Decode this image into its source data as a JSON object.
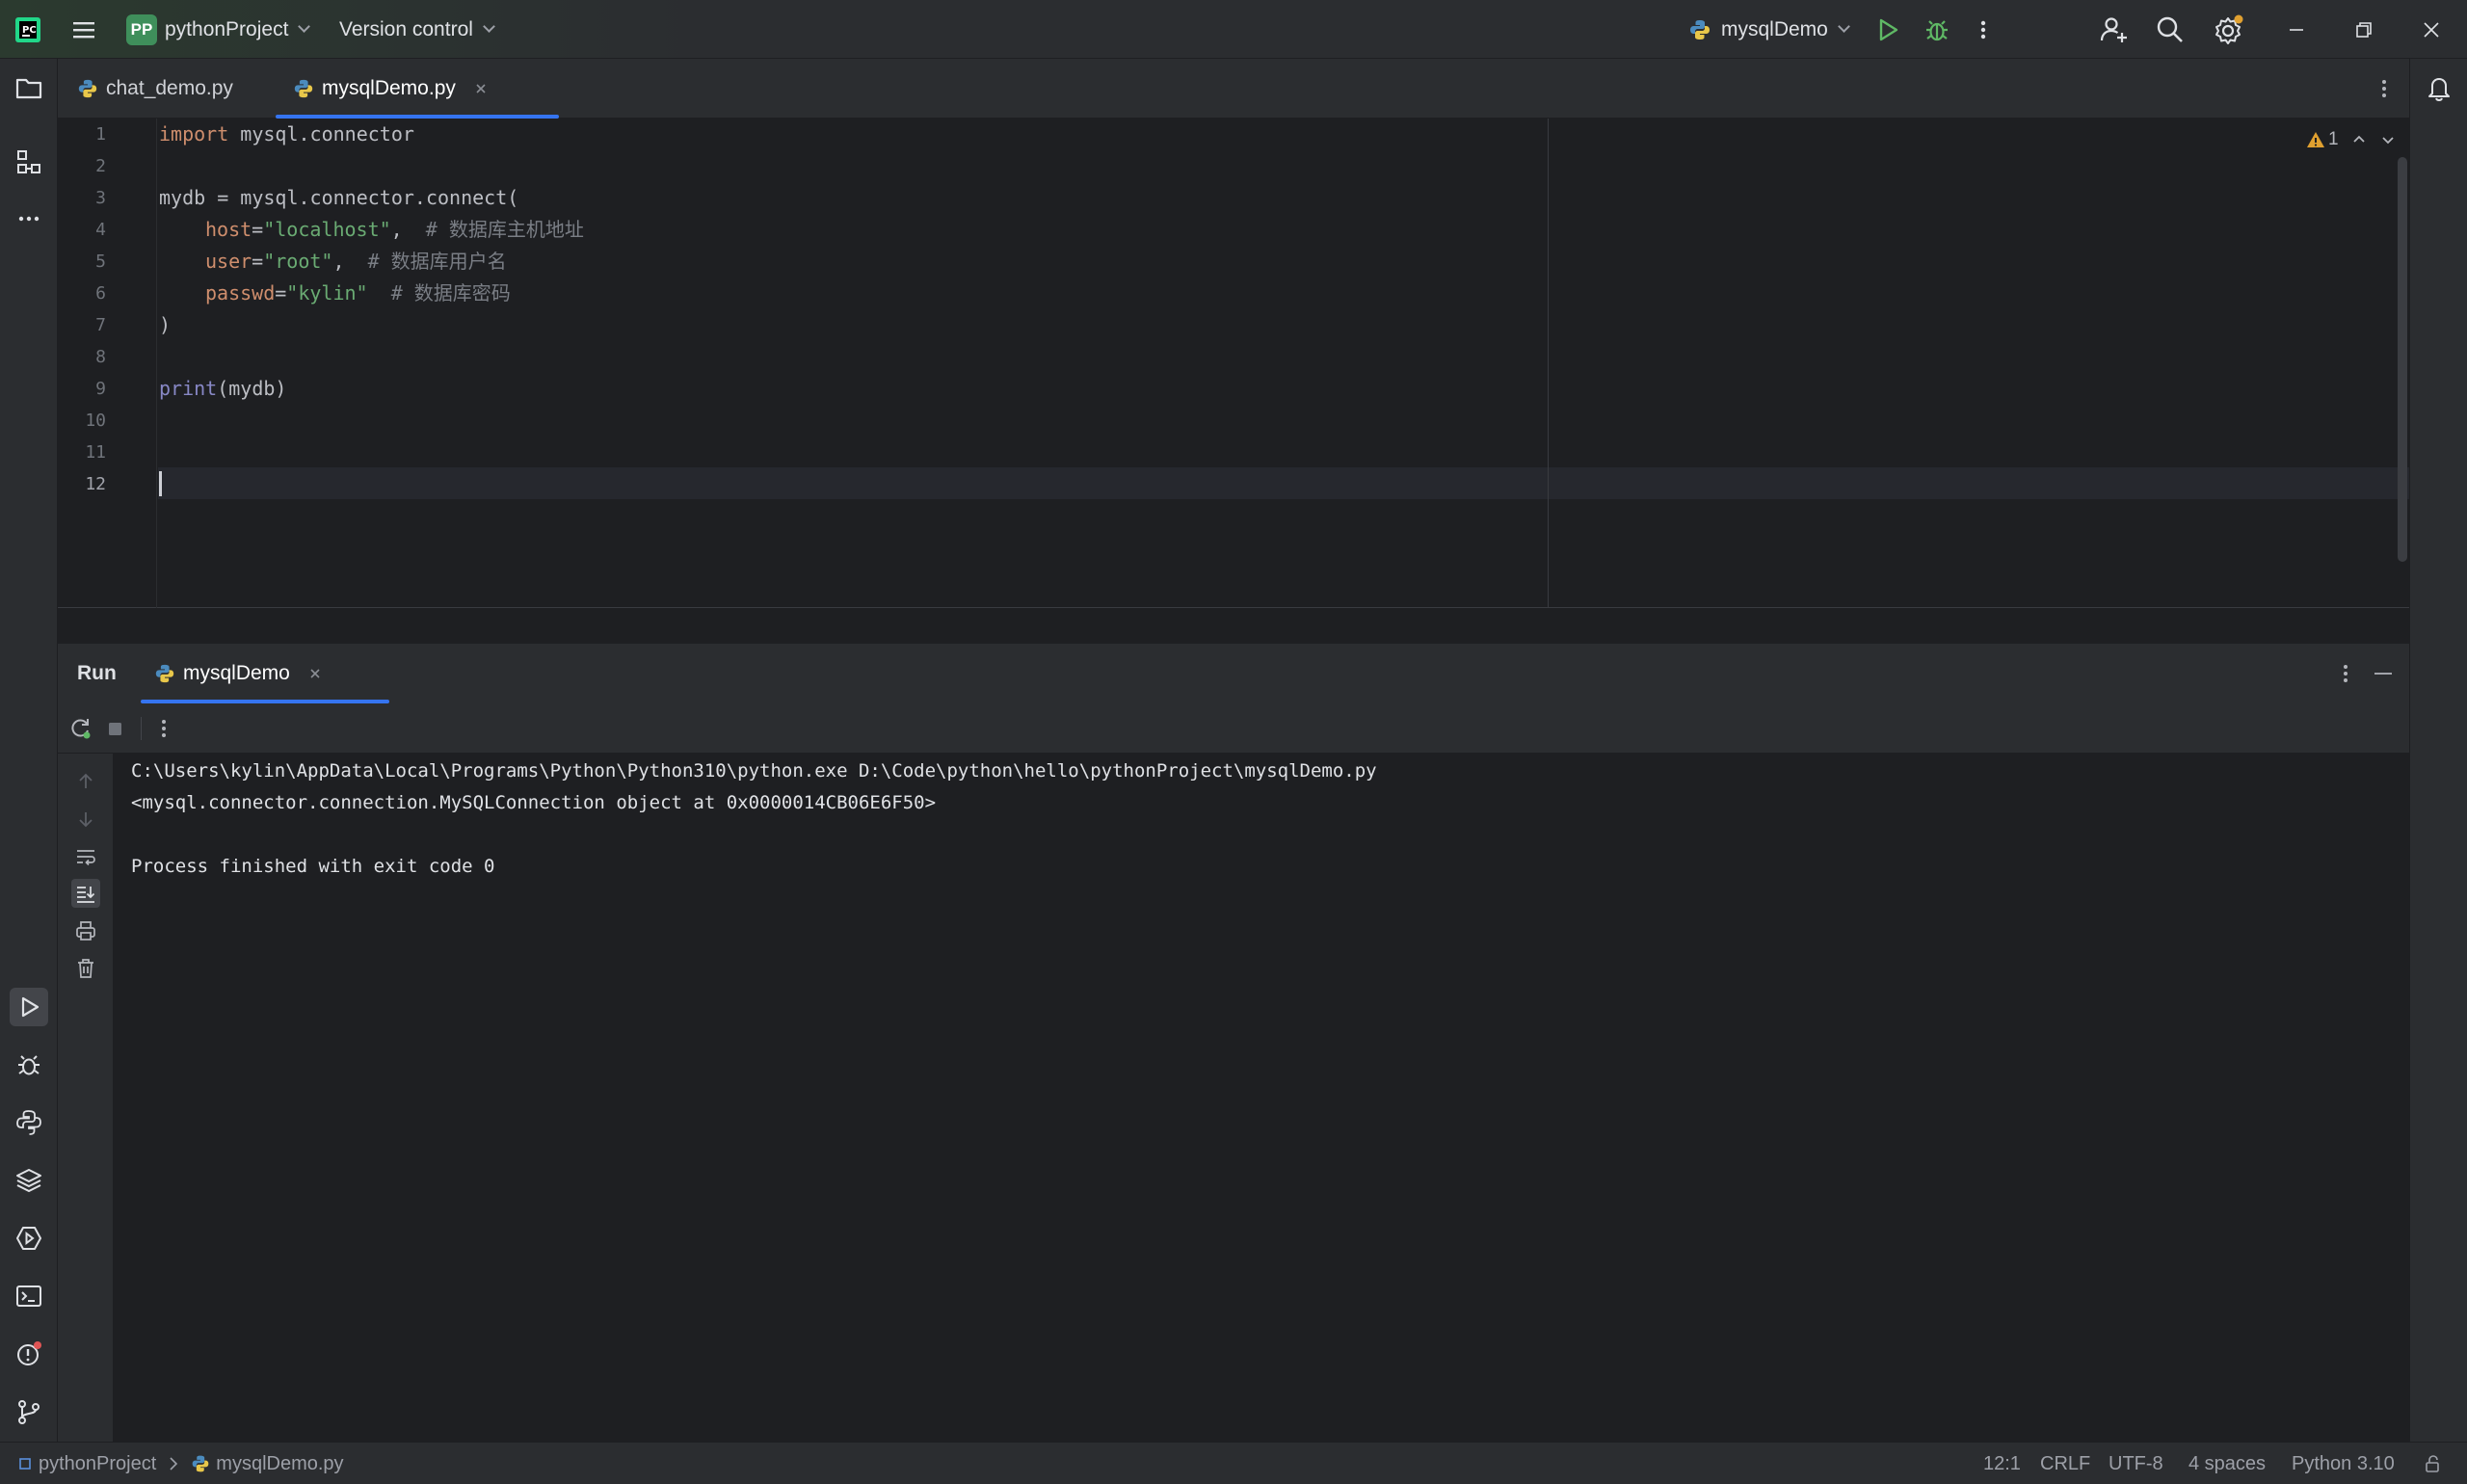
{
  "titlebar": {
    "project_badge": "PP",
    "project_name": "pythonProject",
    "version_control": "Version control",
    "run_config": "mysqlDemo"
  },
  "tabs": [
    {
      "label": "chat_demo.py",
      "active": false
    },
    {
      "label": "mysqlDemo.py",
      "active": true
    }
  ],
  "editor": {
    "line_numbers": [
      "1",
      "2",
      "3",
      "4",
      "5",
      "6",
      "7",
      "8",
      "9",
      "10",
      "11",
      "12"
    ],
    "current_line": "12",
    "lines": {
      "l1_kw": "import",
      "l1_rest": " mysql.connector",
      "l3": "mydb = mysql.connector.connect(",
      "l4_param": "host",
      "l4_eq": "=",
      "l4_str": "\"localhost\"",
      "l4_comma": ",  ",
      "l4_comment": "# 数据库主机地址",
      "l5_param": "user",
      "l5_eq": "=",
      "l5_str": "\"root\"",
      "l5_comma": ",  ",
      "l5_comment": "# 数据库用户名",
      "l6_param": "passwd",
      "l6_eq": "=",
      "l6_str": "\"kylin\"",
      "l6_sp": "  ",
      "l6_comment": "# 数据库密码",
      "l7": ")",
      "l9_fn": "print",
      "l9_rest": "(mydb)"
    },
    "warning_count": "1"
  },
  "run_panel": {
    "title": "Run",
    "tab_label": "mysqlDemo",
    "output": [
      "C:\\Users\\kylin\\AppData\\Local\\Programs\\Python\\Python310\\python.exe D:\\Code\\python\\hello\\pythonProject\\mysqlDemo.py",
      "<mysql.connector.connection.MySQLConnection object at 0x0000014CB06E6F50>",
      "",
      "Process finished with exit code 0"
    ]
  },
  "statusbar": {
    "breadcrumb_project": "pythonProject",
    "breadcrumb_file": "mysqlDemo.py",
    "position": "12:1",
    "line_separator": "CRLF",
    "encoding": "UTF-8",
    "indent": "4 spaces",
    "interpreter": "Python 3.10"
  },
  "colors": {
    "accent": "#3574f0",
    "run_green": "#5fb865",
    "warning": "#e0a030",
    "keyword": "#cf8e6d",
    "string": "#6aab73",
    "comment": "#7a7e85"
  }
}
